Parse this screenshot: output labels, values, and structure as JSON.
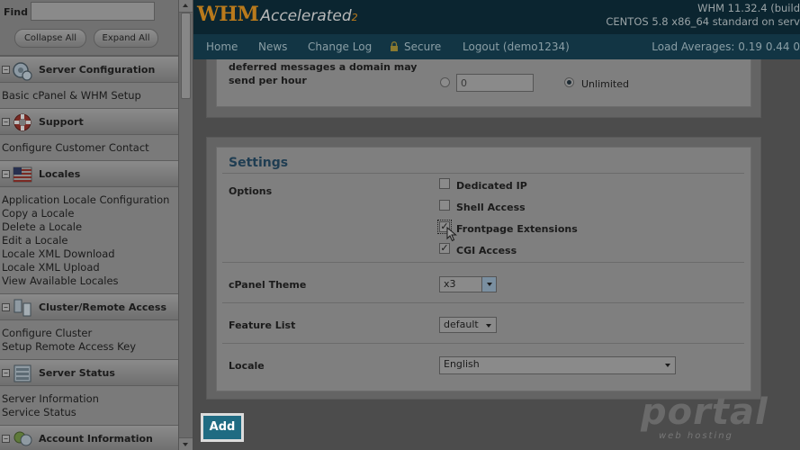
{
  "sidebar": {
    "find_label": "Find",
    "find_value": "",
    "collapse_label": "Collapse All",
    "expand_label": "Expand All",
    "categories": [
      {
        "label": "Server Configuration",
        "icon": "server-config-icon",
        "links": [
          "Basic cPanel & WHM Setup"
        ]
      },
      {
        "label": "Support",
        "icon": "support-lifebuoy-icon",
        "links": [
          "Configure Customer Contact"
        ]
      },
      {
        "label": "Locales",
        "icon": "locales-flag-icon",
        "links": [
          "Application Locale Configuration",
          "Copy a Locale",
          "Delete a Locale",
          "Edit a Locale",
          "Locale XML Download",
          "Locale XML Upload",
          "View Available Locales"
        ]
      },
      {
        "label": "Cluster/Remote Access",
        "icon": "cluster-icon",
        "links": [
          "Configure Cluster",
          "Setup Remote Access Key"
        ]
      },
      {
        "label": "Server Status",
        "icon": "server-status-icon",
        "links": [
          "Server Information",
          "Service Status"
        ]
      },
      {
        "label": "Account Information",
        "icon": "account-info-icon",
        "links": []
      }
    ]
  },
  "header": {
    "logo_whm": "WHM",
    "logo_accelerated": "Accelerated",
    "logo_version": "2",
    "version_line1": "WHM 11.32.4 (build",
    "version_line2": "CENTOS 5.8 x86_64 standard on serv"
  },
  "nav": {
    "items": [
      "Home",
      "News",
      "Change Log",
      "Secure",
      "Logout (demo1234)"
    ],
    "load_averages": "Load Averages: 0.19 0.44 0"
  },
  "form": {
    "deferred_label": "Maximum percentage of failed or deferred messages a domain may send per hour",
    "deferred_value": "0",
    "unlimited_label": "Unlimited",
    "settings_title": "Settings",
    "options_label": "Options",
    "options": [
      {
        "label": "Dedicated IP",
        "checked": false
      },
      {
        "label": "Shell Access",
        "checked": false
      },
      {
        "label": "Frontpage Extensions",
        "checked": true
      },
      {
        "label": "CGI Access",
        "checked": true
      }
    ],
    "theme_label": "cPanel Theme",
    "theme_value": "x3",
    "feature_list_label": "Feature List",
    "feature_list_value": "default",
    "locale_label": "Locale",
    "locale_value": "English",
    "add_label": "Add"
  },
  "watermark": {
    "text": "portal",
    "subtext": "web hosting"
  },
  "colors": {
    "header_bg": "#0b2530",
    "nav_bg": "#123544",
    "add_button": "#1f6b82",
    "logo_orange": "#b97a1c"
  }
}
